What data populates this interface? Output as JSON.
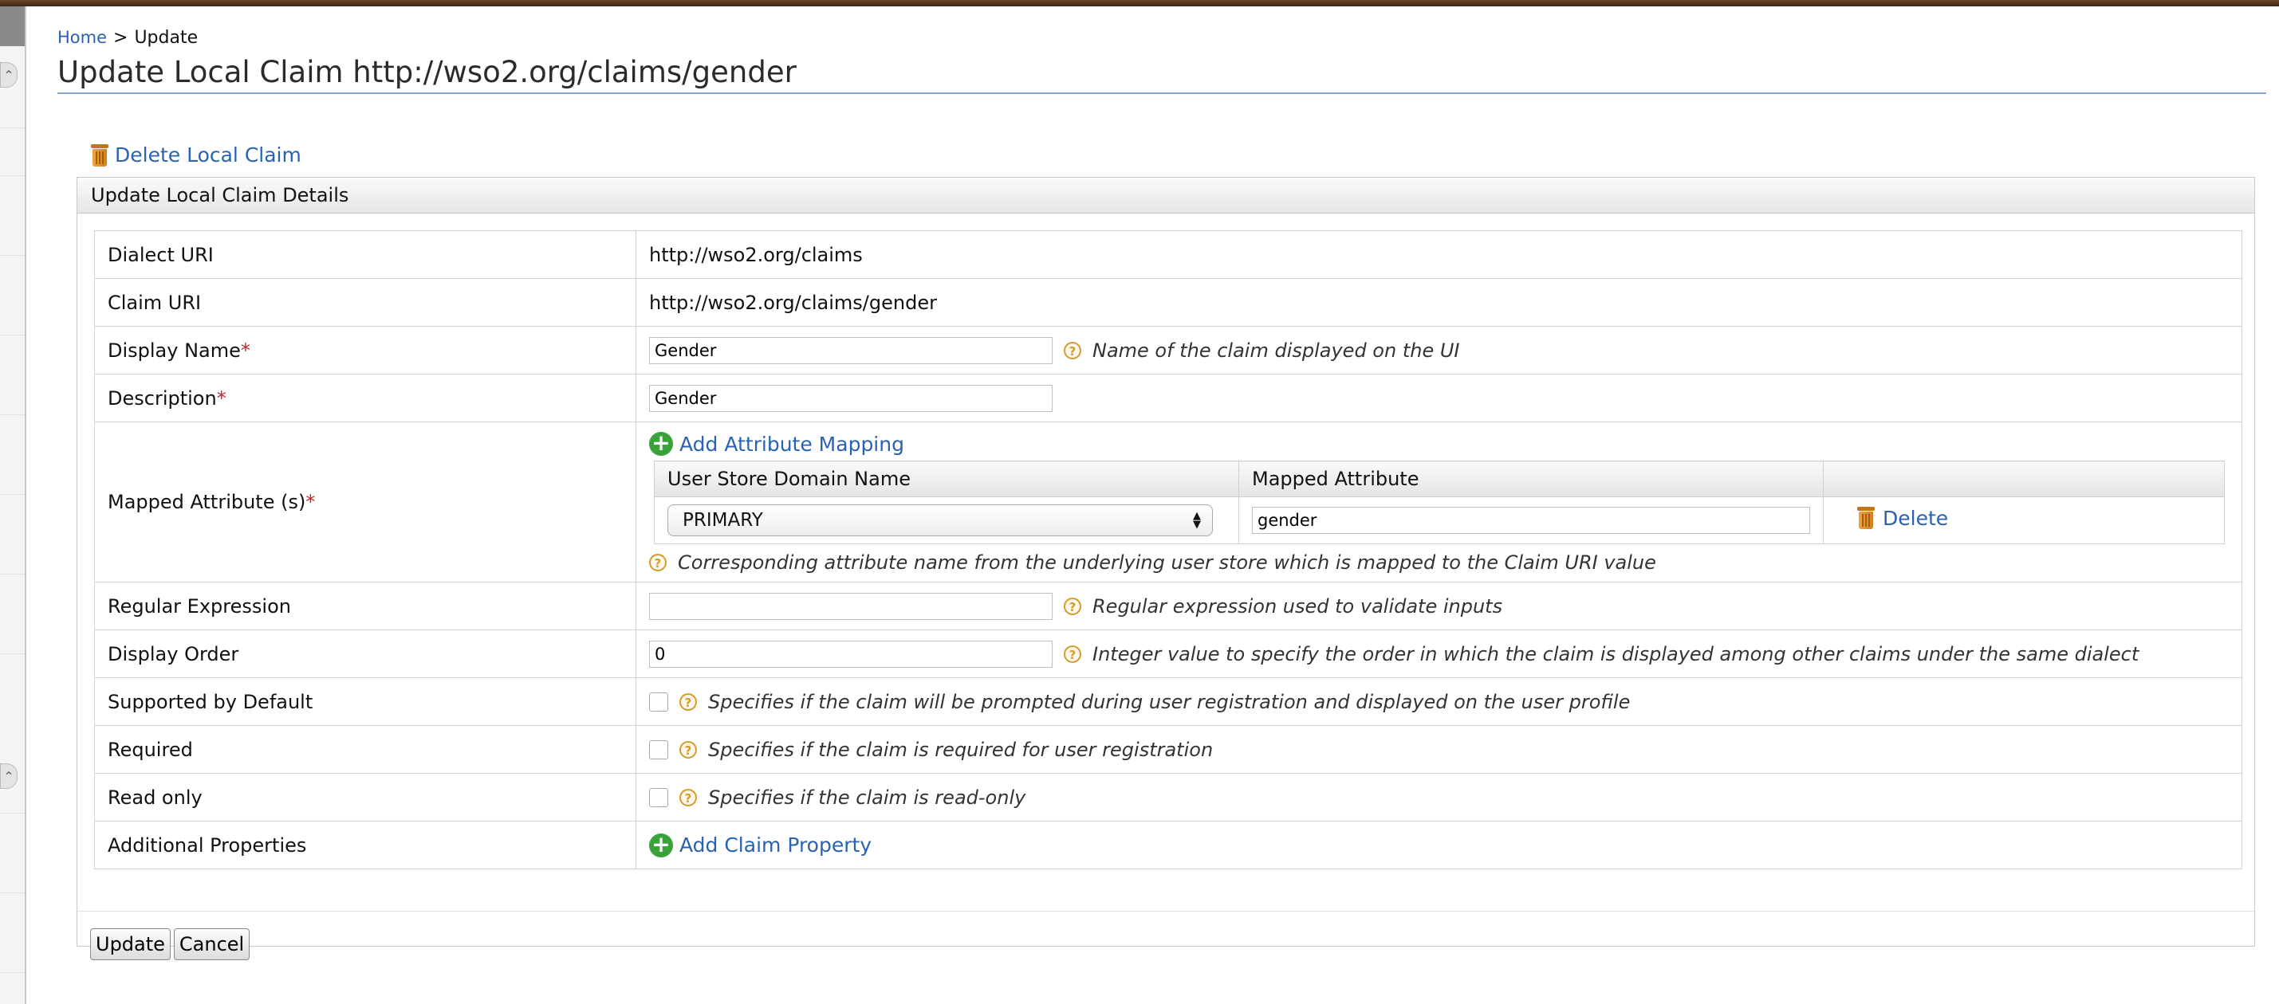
{
  "breadcrumb": {
    "home": "Home",
    "separator": ">",
    "current": "Update"
  },
  "page": {
    "title": "Update Local Claim http://wso2.org/claims/gender"
  },
  "actions": {
    "delete_local_claim": "Delete Local Claim"
  },
  "panel": {
    "heading": "Update Local Claim Details"
  },
  "form": {
    "dialect_uri": {
      "label": "Dialect URI",
      "value": "http://wso2.org/claims"
    },
    "claim_uri": {
      "label": "Claim URI",
      "value": "http://wso2.org/claims/gender"
    },
    "display_name": {
      "label": "Display Name",
      "required_mark": "*",
      "value": "Gender",
      "hint": "Name of the claim displayed on the UI"
    },
    "description": {
      "label": "Description",
      "required_mark": "*",
      "value": "Gender"
    },
    "mapped_attributes": {
      "label": "Mapped Attribute (s)",
      "required_mark": "*",
      "add_label": "Add Attribute Mapping",
      "col_domain": "User Store Domain Name",
      "col_attribute": "Mapped Attribute",
      "rows": [
        {
          "domain": "PRIMARY",
          "attribute": "gender",
          "delete_label": "Delete"
        }
      ],
      "hint": "Corresponding attribute name from the underlying user store which is mapped to the Claim URI value"
    },
    "regex": {
      "label": "Regular Expression",
      "value": "",
      "hint": "Regular expression used to validate inputs"
    },
    "display_order": {
      "label": "Display Order",
      "value": "0",
      "hint": "Integer value to specify the order in which the claim is displayed among other claims under the same dialect"
    },
    "supported_by_default": {
      "label": "Supported by Default",
      "checked": false,
      "hint": "Specifies if the claim will be prompted during user registration and displayed on the user profile"
    },
    "required": {
      "label": "Required",
      "checked": false,
      "hint": "Specifies if the claim is required for user registration"
    },
    "read_only": {
      "label": "Read only",
      "checked": false,
      "hint": "Specifies if the claim is read-only"
    },
    "additional_properties": {
      "label": "Additional Properties",
      "add_label": "Add Claim Property"
    }
  },
  "buttons": {
    "update": "Update",
    "cancel": "Cancel"
  },
  "icons": {
    "help": "help-icon",
    "trash": "trash-icon",
    "add": "add-icon"
  },
  "colors": {
    "link": "#2a62b3",
    "required": "#c0262c",
    "add_icon": "#3aa23a",
    "help_icon": "#d59b2b"
  }
}
